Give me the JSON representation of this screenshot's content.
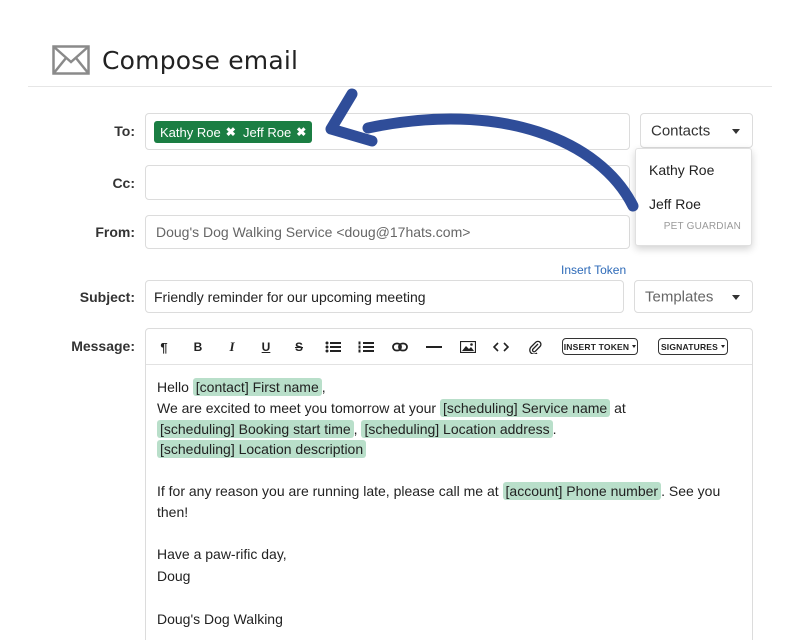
{
  "header": {
    "title": "Compose email",
    "icon": "envelope-icon"
  },
  "labels": {
    "to": "To:",
    "cc": "Cc:",
    "from": "From:",
    "subject": "Subject:",
    "message": "Message:"
  },
  "to": {
    "chips": [
      "Kathy Roe",
      "Jeff Roe"
    ],
    "remove_glyph": "✖"
  },
  "contacts": {
    "label": "Contacts",
    "options": [
      {
        "name": "Kathy Roe"
      },
      {
        "name": "Jeff Roe",
        "sub": "PET GUARDIAN"
      }
    ]
  },
  "from": {
    "value": "Doug's Dog Walking Service <doug@17hats.com>"
  },
  "insert_token_link": "Insert Token",
  "subject": {
    "value": "Friendly reminder for our upcoming meeting"
  },
  "templates": {
    "label": "Templates"
  },
  "toolbar": {
    "buttons": [
      "paragraph-icon",
      "bold-icon",
      "italic-icon",
      "underline-icon",
      "strikethrough-icon",
      "bullet-list-icon",
      "numbered-list-icon",
      "link-icon",
      "horizontal-rule-icon",
      "image-icon",
      "code-icon",
      "attachment-icon"
    ],
    "insert_token": "INSERT TOKEN",
    "signatures": "SIGNATURES"
  },
  "message": {
    "l1_hello": "Hello ",
    "tok_first_name": "[contact] First name",
    "l1_end": ",",
    "l2_text": "We are excited to meet you tomorrow at your ",
    "tok_service": "[scheduling] Service name",
    "l2_end": " at",
    "tok_booking": "[scheduling] Booking start time",
    "l3_comma": ", ",
    "tok_location": "[scheduling] Location address",
    "l3_end": ".",
    "tok_location_desc": "[scheduling] Location description",
    "l5_text": "If for any reason you are running late, please call me at ",
    "tok_phone": "[account] Phone number",
    "l5_end": ". See you",
    "l6_text": "then!",
    "l7_text": "Have a paw-rific day,",
    "l8_text": "Doug",
    "l9_text": "Doug's Dog Walking"
  },
  "colors": {
    "chip": "#1b7e43",
    "token": "#b9dfca",
    "arrow": "#2f4d99",
    "link": "#2d6ab8"
  }
}
